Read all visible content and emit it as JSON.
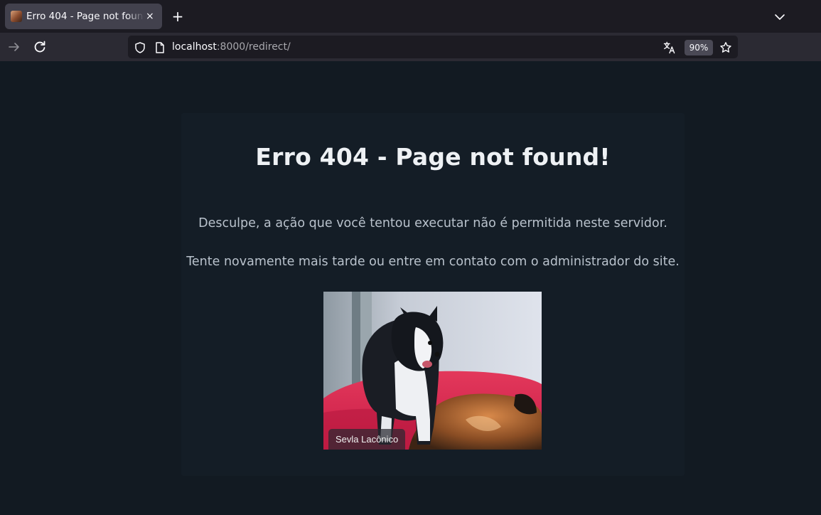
{
  "browser": {
    "tab": {
      "title": "Erro 404 - Page not found!",
      "close_label": "×"
    },
    "new_tab_label": "+",
    "url": {
      "host": "localhost",
      "rest": ":8000/redirect/"
    },
    "zoom": "90%"
  },
  "page": {
    "title": "Erro 404 - Page not found!",
    "message_1": "Desculpe, a ação que você tentou executar não é permitida neste servidor.",
    "message_2": "Tente novamente mais tarde ou entre em contato com o administrador do site.",
    "photo": {
      "caption": "Sevla Lacônico"
    }
  },
  "colors": {
    "page_background": "#121a22",
    "card_background": "#141d26",
    "chrome_tabbar": "#1c1b22",
    "chrome_navbar": "#2b2a33"
  },
  "icons": {
    "tab_favicon": "dog-favicon-icon",
    "tab_close": "close-icon",
    "new_tab": "plus-icon",
    "tab_list": "chevron-down-icon",
    "forward": "arrow-right-icon",
    "reload": "reload-icon",
    "tracking_protection": "shield-icon",
    "page_info": "page-icon",
    "translate": "translate-icon",
    "bookmark": "star-icon"
  }
}
